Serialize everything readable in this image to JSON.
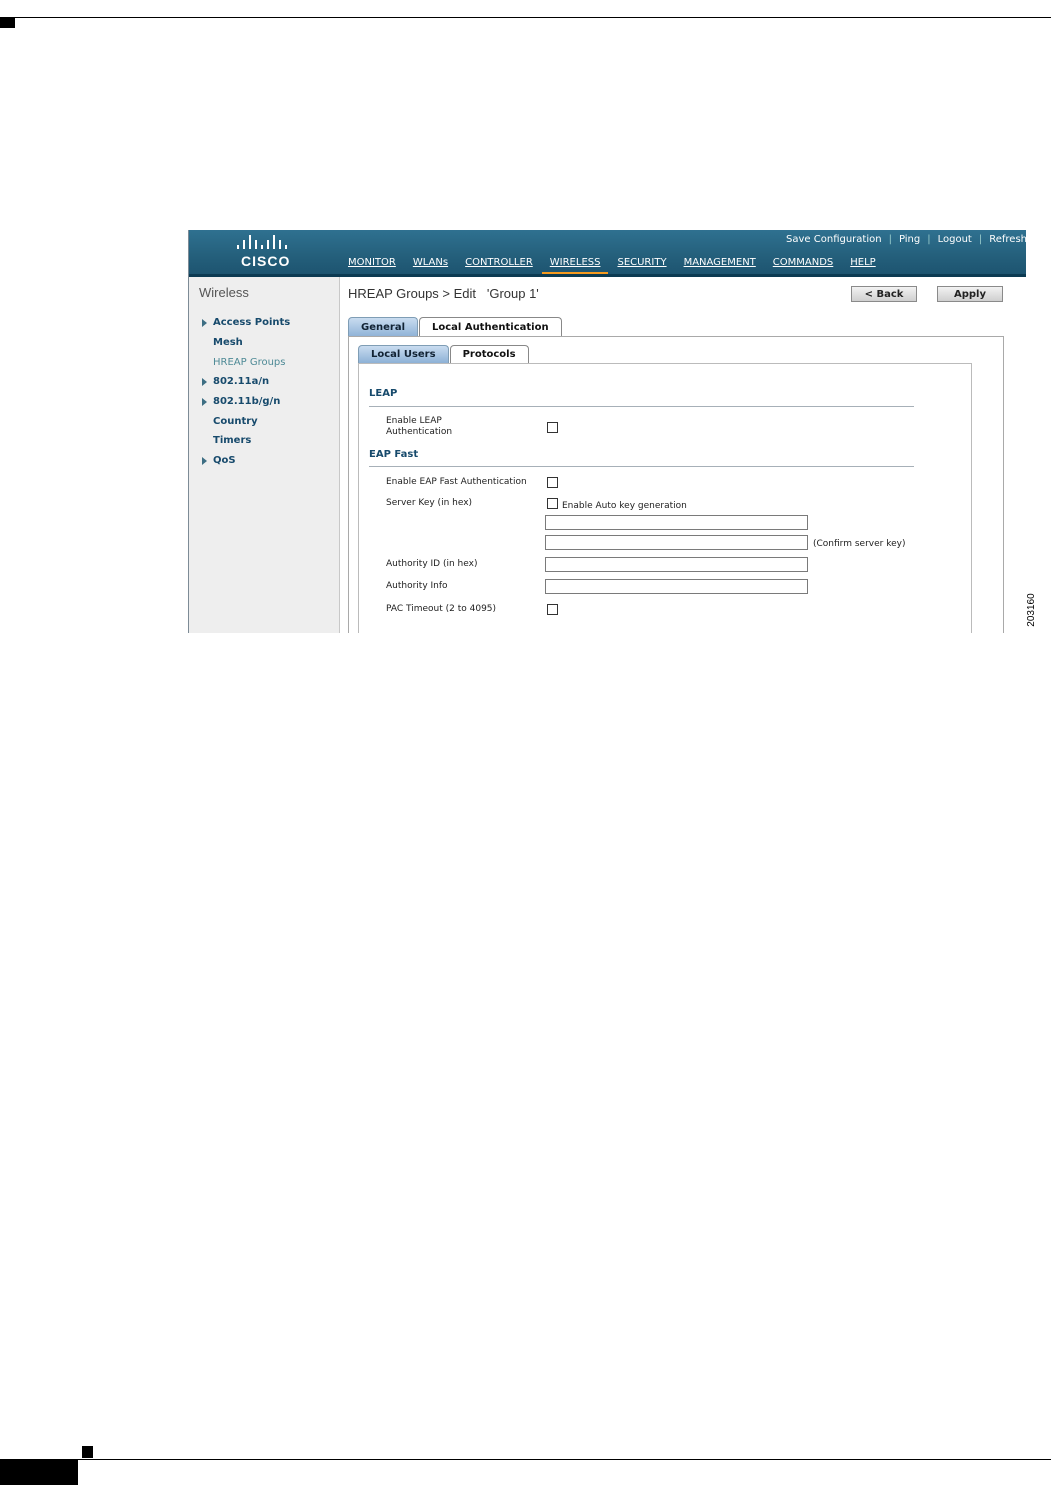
{
  "header": {
    "logo_text": "CISCO",
    "util_links": [
      "Save Configuration",
      "Ping",
      "Logout",
      "Refresh"
    ],
    "nav": [
      "MONITOR",
      "WLANs",
      "CONTROLLER",
      "WIRELESS",
      "SECURITY",
      "MANAGEMENT",
      "COMMANDS",
      "HELP"
    ],
    "active_nav": "WIRELESS"
  },
  "sidebar": {
    "title": "Wireless",
    "items": [
      {
        "label": "Access Points",
        "expandable": true
      },
      {
        "label": "Mesh",
        "expandable": false
      },
      {
        "label": "HREAP Groups",
        "expandable": false,
        "selected": true
      },
      {
        "label": "802.11a/n",
        "expandable": true
      },
      {
        "label": "802.11b/g/n",
        "expandable": true
      },
      {
        "label": "Country",
        "expandable": false
      },
      {
        "label": "Timers",
        "expandable": false
      },
      {
        "label": "QoS",
        "expandable": true
      }
    ]
  },
  "main": {
    "title": "HREAP Groups > Edit   'Group 1'",
    "back_label": "< Back",
    "apply_label": "Apply",
    "tabs": [
      "General",
      "Local Authentication"
    ],
    "subtabs": [
      "Local Users",
      "Protocols"
    ],
    "leap": {
      "heading": "LEAP",
      "enable_label_1": "Enable LEAP",
      "enable_label_2": "Authentication",
      "enabled": false
    },
    "eap_fast": {
      "heading": "EAP Fast",
      "enable_label": "Enable EAP Fast Authentication",
      "enabled": false,
      "server_key_label": "Server Key (in hex)",
      "auto_key_label": "Enable Auto key generation",
      "auto_key_enabled": false,
      "server_key_value": "",
      "confirm_key_value": "",
      "confirm_hint": "(Confirm server key)",
      "authority_id_label": "Authority ID (in hex)",
      "authority_id_value": "",
      "authority_info_label": "Authority Info",
      "authority_info_value": "",
      "pac_timeout_label": "PAC Timeout (2 to 4095)",
      "pac_timeout_enabled": false
    }
  },
  "figure_number": "203160",
  "colors": {
    "header": "#245f7b",
    "accent": "#f59a1f",
    "section_text": "#174a6c"
  }
}
